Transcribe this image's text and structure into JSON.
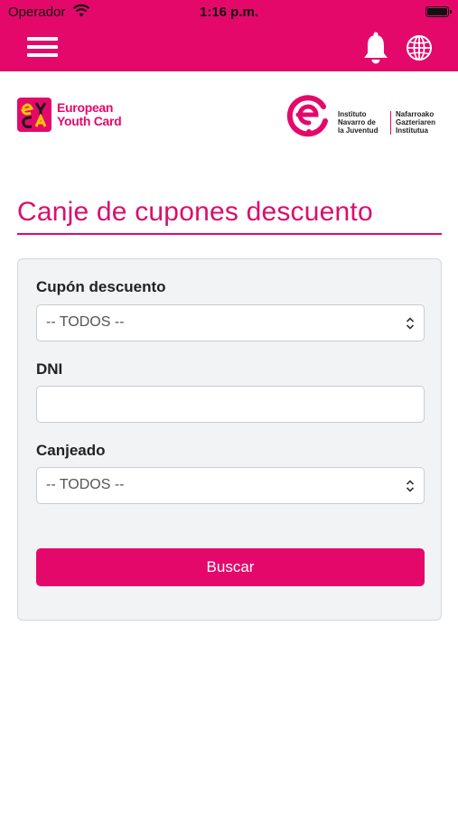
{
  "status_bar": {
    "carrier": "Operador",
    "time": "1:16 p.m.",
    "battery_level": 1.0
  },
  "nav": {
    "icons": [
      "menu-icon",
      "bell-icon",
      "globe-icon"
    ]
  },
  "logos": {
    "eyca_line1": "European",
    "eyca_line2": "Youth Card",
    "inj_col1": [
      "Instituto",
      "Navarro de",
      "la Juventud"
    ],
    "inj_col2": [
      "Nafarroako",
      "Gazteriaren",
      "Institutua"
    ]
  },
  "page": {
    "title": "Canje de cupones descuento"
  },
  "form": {
    "coupon_label": "Cupón descuento",
    "coupon_value": "-- TODOS --",
    "dni_label": "DNI",
    "dni_value": "",
    "redeemed_label": "Canjeado",
    "redeemed_value": "-- TODOS --",
    "search_label": "Buscar"
  },
  "colors": {
    "brand": "#e5086b",
    "card_bg": "#f2f3f5"
  }
}
